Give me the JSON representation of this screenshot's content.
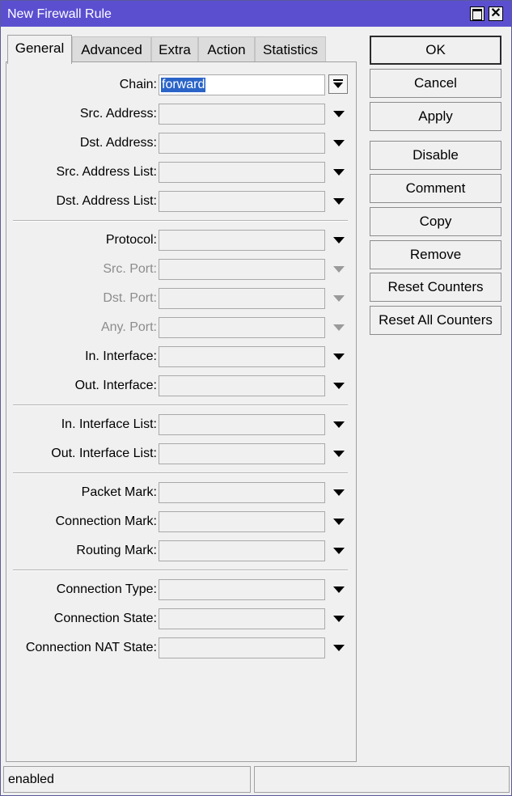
{
  "window": {
    "title": "New Firewall Rule"
  },
  "tabs": [
    {
      "label": "General",
      "active": true
    },
    {
      "label": "Advanced",
      "active": false
    },
    {
      "label": "Extra",
      "active": false
    },
    {
      "label": "Action",
      "active": false
    },
    {
      "label": "Statistics",
      "active": false
    }
  ],
  "general": {
    "chain": {
      "label": "Chain:",
      "value": "forward"
    },
    "src_address": {
      "label": "Src. Address:"
    },
    "dst_address": {
      "label": "Dst. Address:"
    },
    "src_address_list": {
      "label": "Src. Address List:"
    },
    "dst_address_list": {
      "label": "Dst. Address List:"
    },
    "protocol": {
      "label": "Protocol:"
    },
    "src_port": {
      "label": "Src. Port:"
    },
    "dst_port": {
      "label": "Dst. Port:"
    },
    "any_port": {
      "label": "Any. Port:"
    },
    "in_interface": {
      "label": "In. Interface:"
    },
    "out_interface": {
      "label": "Out. Interface:"
    },
    "in_interface_list": {
      "label": "In. Interface List:"
    },
    "out_interface_list": {
      "label": "Out. Interface List:"
    },
    "packet_mark": {
      "label": "Packet Mark:"
    },
    "connection_mark": {
      "label": "Connection Mark:"
    },
    "routing_mark": {
      "label": "Routing Mark:"
    },
    "connection_type": {
      "label": "Connection Type:"
    },
    "connection_state": {
      "label": "Connection State:"
    },
    "connection_nat_state": {
      "label": "Connection NAT State:"
    }
  },
  "buttons": {
    "ok": "OK",
    "cancel": "Cancel",
    "apply": "Apply",
    "disable": "Disable",
    "comment": "Comment",
    "copy": "Copy",
    "remove": "Remove",
    "reset_counters": "Reset Counters",
    "reset_all_counters": "Reset All Counters"
  },
  "status": {
    "left": "enabled",
    "right": ""
  },
  "colors": {
    "titlebar": "#5b4fd0",
    "selection": "#2a64c8",
    "window_bg": "#f0f0f0"
  }
}
